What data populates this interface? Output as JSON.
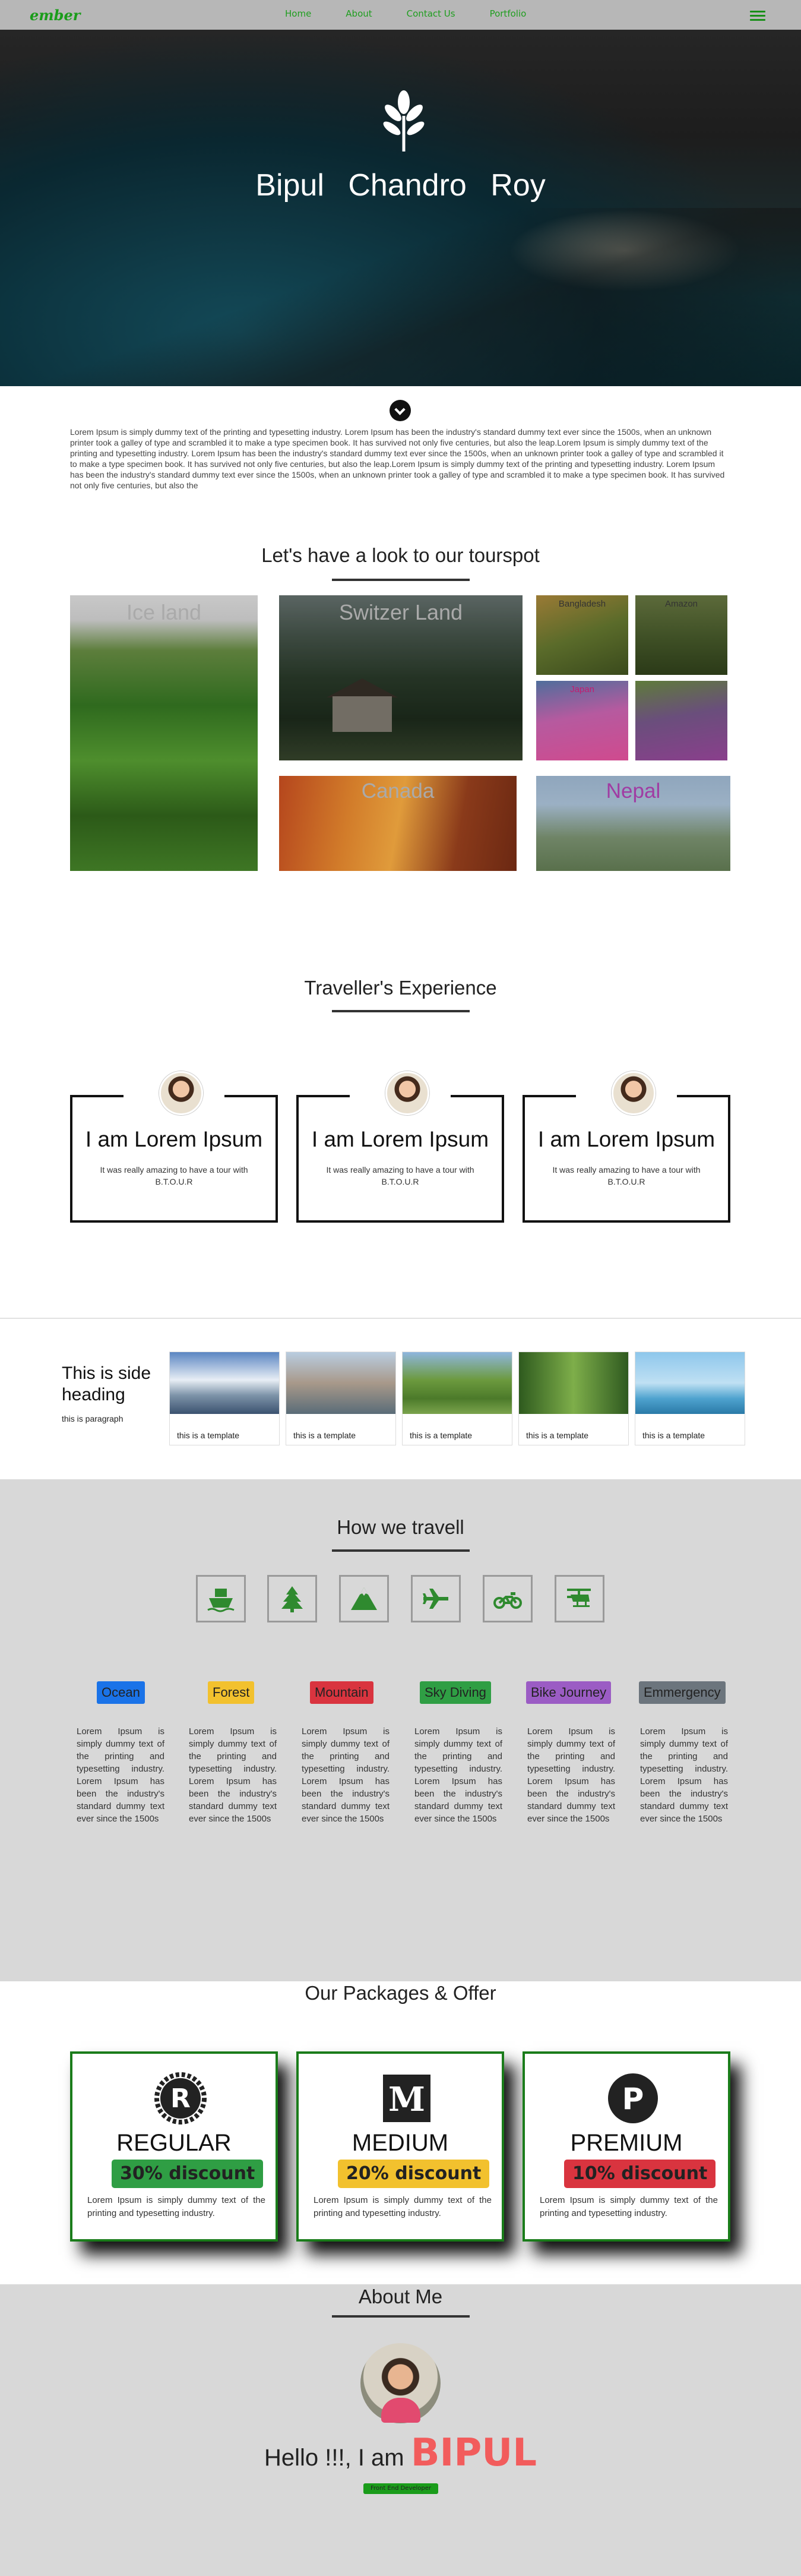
{
  "nav": {
    "brand": "ember",
    "links": [
      "Home",
      "About",
      "Contact Us",
      "Portfolio"
    ]
  },
  "hero": {
    "title": "Bipul Chandro Roy"
  },
  "intro": {
    "text": "Lorem Ipsum is simply dummy text of the printing and typesetting industry. Lorem Ipsum has been the industry's standard dummy text ever since the 1500s, when an unknown printer took a galley of type and scrambled it to make a type specimen book. It has survived not only five centuries, but also the leap.Lorem Ipsum is simply dummy text of the printing and typesetting industry. Lorem Ipsum has been the industry's standard dummy text ever since the 1500s, when an unknown printer took a galley of type and scrambled it to make a type specimen book. It has survived not only five centuries, but also the leap.Lorem Ipsum is simply dummy text of the printing and typesetting industry. Lorem Ipsum has been the industry's standard dummy text ever since the 1500s, when an unknown printer took a galley of type and scrambled it to make a type specimen book. It has survived not only five centuries, but also the"
  },
  "tourspot": {
    "title": "Let's have a look to our tourspot",
    "places": {
      "iceland": "Ice land",
      "switzerland": "Switzer Land",
      "bangladesh": "Bangladesh",
      "amazon": "Amazon",
      "japan": "Japan",
      "flower": "",
      "canada": "Canada",
      "nepal": "Nepal"
    }
  },
  "experience": {
    "title": "Traveller's Experience",
    "cards": [
      {
        "title": "I am Lorem Ipsum",
        "text": "It was really amazing to have a tour with B.T.O.U.R"
      },
      {
        "title": "I am Lorem Ipsum",
        "text": "It was really amazing to have a tour with B.T.O.U.R"
      },
      {
        "title": "I am Lorem Ipsum",
        "text": "It was really amazing to have a tour with B.T.O.U.R"
      }
    ]
  },
  "side": {
    "heading": "This is side heading",
    "paragraph": "this is paragraph",
    "cards": [
      {
        "caption": "this is a template",
        "color": "#4a6fa5"
      },
      {
        "caption": "this is a template",
        "color": "#8a9aa3"
      },
      {
        "caption": "this is a template",
        "color": "#5a8a3c"
      },
      {
        "caption": "this is a template",
        "color": "#3e6b2c"
      },
      {
        "caption": "this is a template",
        "color": "#4fa3cf"
      }
    ]
  },
  "travel": {
    "title": "How we travell",
    "icons": [
      "ship-icon",
      "tree-icon",
      "mountain-icon",
      "plane-icon",
      "motorcycle-icon",
      "helicopter-icon"
    ],
    "items": [
      {
        "label": "Ocean",
        "bg": "#1a73e8",
        "fg": "#111",
        "text": "Lorem Ipsum is simply dummy text of the printing and typesetting industry. Lorem Ipsum has been the industry's standard dummy text ever since the 1500s"
      },
      {
        "label": "Forest",
        "bg": "#f2c12e",
        "fg": "#111",
        "text": "Lorem Ipsum is simply dummy text of the printing and typesetting industry. Lorem Ipsum has been the industry's standard dummy text ever since the 1500s"
      },
      {
        "label": "Mountain",
        "bg": "#d9343f",
        "fg": "#111",
        "text": "Lorem Ipsum is simply dummy text of the printing and typesetting industry. Lorem Ipsum has been the industry's standard dummy text ever since the 1500s"
      },
      {
        "label": "Sky Diving",
        "bg": "#2f9e44",
        "fg": "#111",
        "text": "Lorem Ipsum is simply dummy text of the printing and typesetting industry. Lorem Ipsum has been the industry's standard dummy text ever since the 1500s"
      },
      {
        "label": "Bike Journey",
        "bg": "#9b5cc4",
        "fg": "#111",
        "text": "Lorem Ipsum is simply dummy text of the printing and typesetting industry. Lorem Ipsum has been the industry's standard dummy text ever since the 1500s"
      },
      {
        "label": "Emmergency",
        "bg": "#6c757d",
        "fg": "#111",
        "text": "Lorem Ipsum is simply dummy text of the printing and typesetting industry. Lorem Ipsum has been the industry's standard dummy text ever since the 1500s"
      }
    ]
  },
  "packages": {
    "title": "Our Packages & Offer",
    "items": [
      {
        "name": "REGULAR",
        "discount": "30% discount",
        "discount_bg": "#2f9e44",
        "icon": "rust-icon",
        "text": "Lorem Ipsum is simply dummy text of the printing and typesetting industry."
      },
      {
        "name": "MEDIUM",
        "discount": "20% discount",
        "discount_bg": "#f2c12e",
        "icon": "medium-icon",
        "text": "Lorem Ipsum is simply dummy text of the printing and typesetting industry."
      },
      {
        "name": "PREMIUM",
        "discount": "10% discount",
        "discount_bg": "#d9343f",
        "icon": "producthunt-icon",
        "text": "Lorem Ipsum is simply dummy text of the printing and typesetting industry."
      }
    ]
  },
  "about": {
    "title": "About Me",
    "hello": "Hello !!!, I am",
    "name": "BIPUL",
    "role": "Front End Developer"
  }
}
